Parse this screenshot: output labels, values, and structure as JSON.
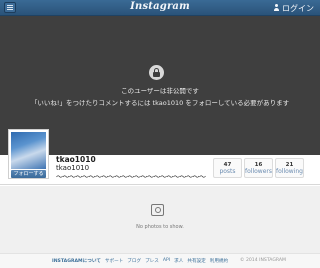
{
  "header": {
    "logo_text": "Instagram",
    "login_label": "ログイン"
  },
  "private": {
    "title": "このユーザーは非公開です",
    "message": "「いいね!」をつけたりコメントするには tkao1010 をフォローしている必要があります"
  },
  "profile": {
    "username": "tkao1010",
    "full_name": "tkao1010",
    "bio": "〜〜〜〜〜〜〜〜〜〜〜〜〜〜〜〜〜〜〜〜〜〜〜",
    "follow_label": "フォローする",
    "stats": [
      {
        "value": "47",
        "label": "posts"
      },
      {
        "value": "16",
        "label": "followers"
      },
      {
        "value": "21",
        "label": "following"
      }
    ]
  },
  "photos": {
    "empty_text": "No photos to show."
  },
  "footer": {
    "links": [
      "INSTAGRAMについて",
      "サポート",
      "ブログ",
      "プレス",
      "API",
      "求人",
      "共有設定",
      "利用規約"
    ],
    "copyright": "© 2014 INSTAGRAM"
  },
  "colors": {
    "header_bg": "#2a5379",
    "private_bg": "#3f3f3f",
    "link": "#3f729b"
  }
}
